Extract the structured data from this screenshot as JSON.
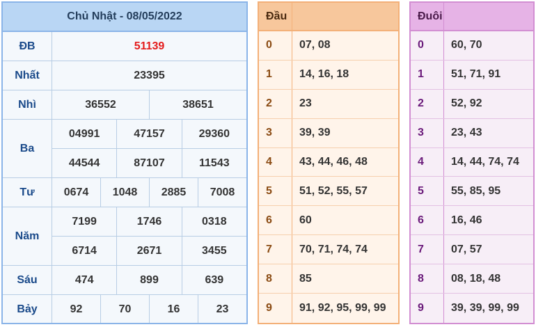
{
  "results": {
    "title": "Chủ Nhật - 08/05/2022",
    "rows": [
      {
        "label": "ĐB",
        "lines": [
          [
            "51139"
          ]
        ]
      },
      {
        "label": "Nhất",
        "lines": [
          [
            "23395"
          ]
        ]
      },
      {
        "label": "Nhì",
        "lines": [
          [
            "36552",
            "38651"
          ]
        ]
      },
      {
        "label": "Ba",
        "lines": [
          [
            "04991",
            "47157",
            "29360"
          ],
          [
            "44544",
            "87107",
            "11543"
          ]
        ]
      },
      {
        "label": "Tư",
        "lines": [
          [
            "0674",
            "1048",
            "2885",
            "7008"
          ]
        ]
      },
      {
        "label": "Năm",
        "lines": [
          [
            "7199",
            "1746",
            "0318"
          ],
          [
            "6714",
            "2671",
            "3455"
          ]
        ]
      },
      {
        "label": "Sáu",
        "lines": [
          [
            "474",
            "899",
            "639"
          ]
        ]
      },
      {
        "label": "Bảy",
        "lines": [
          [
            "92",
            "70",
            "16",
            "23"
          ]
        ]
      }
    ]
  },
  "dau": {
    "title": "Đầu",
    "rows": [
      {
        "k": "0",
        "v": "07, 08"
      },
      {
        "k": "1",
        "v": "14, 16, 18"
      },
      {
        "k": "2",
        "v": "23"
      },
      {
        "k": "3",
        "v": "39, 39"
      },
      {
        "k": "4",
        "v": "43, 44, 46, 48"
      },
      {
        "k": "5",
        "v": "51, 52, 55, 57"
      },
      {
        "k": "6",
        "v": "60"
      },
      {
        "k": "7",
        "v": "70, 71, 74, 74"
      },
      {
        "k": "8",
        "v": "85"
      },
      {
        "k": "9",
        "v": "91, 92, 95, 99, 99"
      }
    ]
  },
  "duoi": {
    "title": "Đuôi",
    "rows": [
      {
        "k": "0",
        "v": "60, 70"
      },
      {
        "k": "1",
        "v": "51, 71, 91"
      },
      {
        "k": "2",
        "v": "52, 92"
      },
      {
        "k": "3",
        "v": "23, 43"
      },
      {
        "k": "4",
        "v": "14, 44, 74, 74"
      },
      {
        "k": "5",
        "v": "55, 85, 95"
      },
      {
        "k": "6",
        "v": "16, 46"
      },
      {
        "k": "7",
        "v": "07, 57"
      },
      {
        "k": "8",
        "v": "08, 18, 48"
      },
      {
        "k": "9",
        "v": "39, 39, 99, 99"
      }
    ]
  },
  "colors": {
    "special_prize": "#e41b1b",
    "results_accent": "#b9d6f4",
    "dau_accent": "#f7c79c",
    "duoi_accent": "#e6b3e6"
  }
}
